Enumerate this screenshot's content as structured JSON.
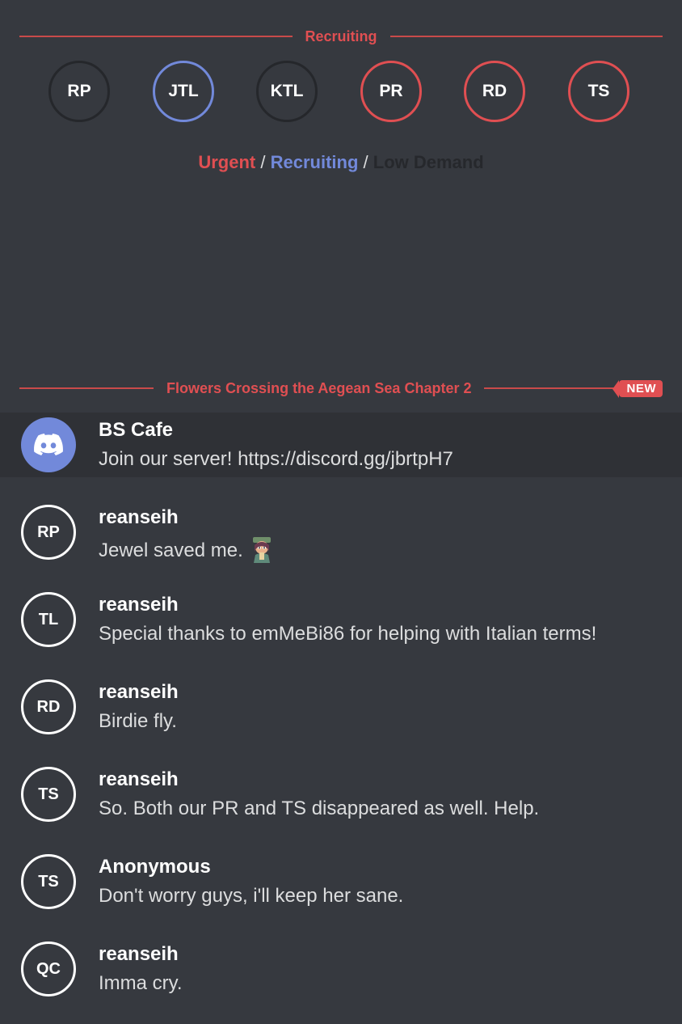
{
  "recruiting_section": {
    "title": "Recruiting",
    "roles": [
      {
        "abbr": "RP",
        "status": "low"
      },
      {
        "abbr": "JTL",
        "status": "recruiting"
      },
      {
        "abbr": "KTL",
        "status": "low"
      },
      {
        "abbr": "PR",
        "status": "urgent"
      },
      {
        "abbr": "RD",
        "status": "urgent"
      },
      {
        "abbr": "TS",
        "status": "urgent"
      }
    ],
    "legend": {
      "urgent": "Urgent",
      "recruiting": "Recruiting",
      "low": "Low Demand",
      "separator": "/"
    }
  },
  "chapter_divider": {
    "title": "Flowers Crossing the Aegean Sea Chapter 2",
    "badge": "NEW"
  },
  "messages": [
    {
      "author": "BS Cafe",
      "text": "Join our server! https://discord.gg/jbrtpH7",
      "avatar": "discord-logo"
    },
    {
      "author": "reanseih",
      "text": "Jewel saved me.",
      "avatar": "RP",
      "emoji": "jewel-character-emoji"
    },
    {
      "author": "reanseih",
      "text": "Special thanks to emMeBi86 for helping with Italian terms!",
      "avatar": "TL"
    },
    {
      "author": "reanseih",
      "text": "Birdie fly.",
      "avatar": "RD"
    },
    {
      "author": "reanseih",
      "text": "So. Both our PR and TS disappeared as well. Help.",
      "avatar": "TS"
    },
    {
      "author": "Anonymous",
      "text": "Don't worry guys, i'll keep her sane.",
      "avatar": "TS"
    },
    {
      "author": "reanseih",
      "text": "Imma cry.",
      "avatar": "QC"
    }
  ],
  "colors": {
    "background": "#36393f",
    "urgent": "#e04f52",
    "recruiting": "#7289da",
    "low_demand": "#26282c",
    "discord_blurple": "#7289da"
  }
}
